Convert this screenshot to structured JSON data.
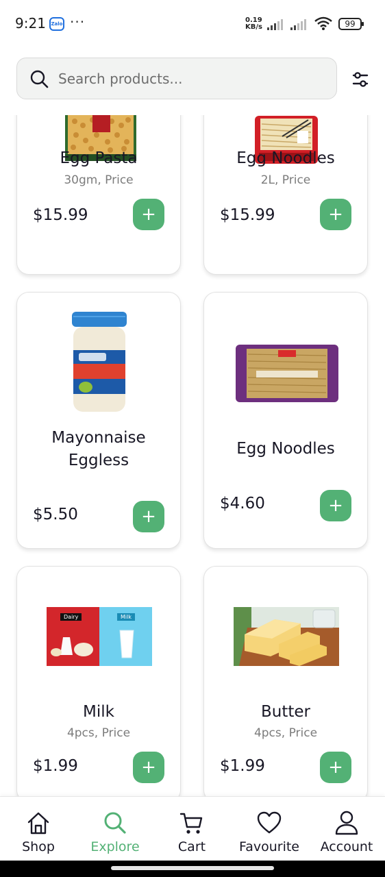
{
  "status_bar": {
    "time": "9:21",
    "app_badge": "Zalo",
    "dots": "···",
    "net_speed_value": "0.19",
    "net_speed_unit": "KB/s",
    "battery": "99"
  },
  "search": {
    "placeholder": "Search products..."
  },
  "products": [
    {
      "name": "Egg Pasta",
      "detail": "30gm, Price",
      "price": "$15.99",
      "add_label": "+"
    },
    {
      "name": "Egg Noodles",
      "detail": "2L, Price",
      "price": "$15.99",
      "add_label": "+"
    },
    {
      "name": "Mayonnaise Eggless",
      "detail": "",
      "price": "$5.50",
      "add_label": "+"
    },
    {
      "name": "Egg Noodles",
      "detail": "",
      "price": "$4.60",
      "add_label": "+"
    },
    {
      "name": "Milk",
      "detail": "4pcs, Price",
      "price": "$1.99",
      "add_label": "+",
      "image_tags": [
        "Dairy",
        "Milk"
      ]
    },
    {
      "name": "Butter",
      "detail": "4pcs, Price",
      "price": "$1.99",
      "add_label": "+"
    }
  ],
  "nav": {
    "items": [
      {
        "label": "Shop",
        "icon": "home-icon"
      },
      {
        "label": "Explore",
        "icon": "search-icon",
        "active": true
      },
      {
        "label": "Cart",
        "icon": "cart-icon"
      },
      {
        "label": "Favourite",
        "icon": "heart-icon"
      },
      {
        "label": "Account",
        "icon": "user-icon"
      }
    ]
  },
  "colors": {
    "accent": "#53B175",
    "text": "#181725",
    "muted": "#7C7C7C"
  }
}
